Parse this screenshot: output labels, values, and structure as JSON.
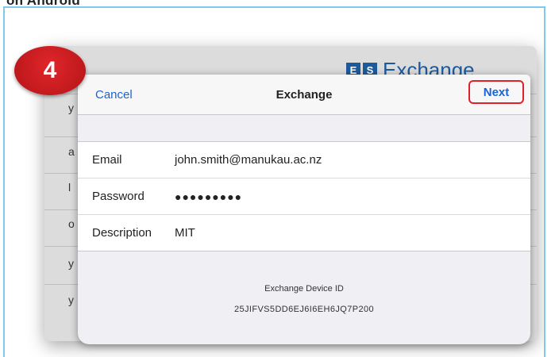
{
  "top_text": "on Android",
  "step_number": "4",
  "background": {
    "logo_mark": "E",
    "logo_mark2": "S",
    "logo_text": "Exchange",
    "left_chars": [
      "y",
      "a",
      "l",
      "o",
      "y",
      "y"
    ]
  },
  "dialog": {
    "cancel_label": "Cancel",
    "title": "Exchange",
    "next_label": "Next",
    "fields": [
      {
        "label": "Email",
        "value": "john.smith@manukau.ac.nz"
      },
      {
        "label": "Password",
        "value": "●●●●●●●●●"
      },
      {
        "label": "Description",
        "value": "MIT"
      }
    ],
    "device_id_label": "Exchange Device ID",
    "device_id_value": "25JIFVS5DD6EJ6I6EH6JQ7P200"
  },
  "colors": {
    "accent_blue": "#1a64d6",
    "highlight_red": "#e0202a",
    "frame_border": "#7fc8ee"
  }
}
